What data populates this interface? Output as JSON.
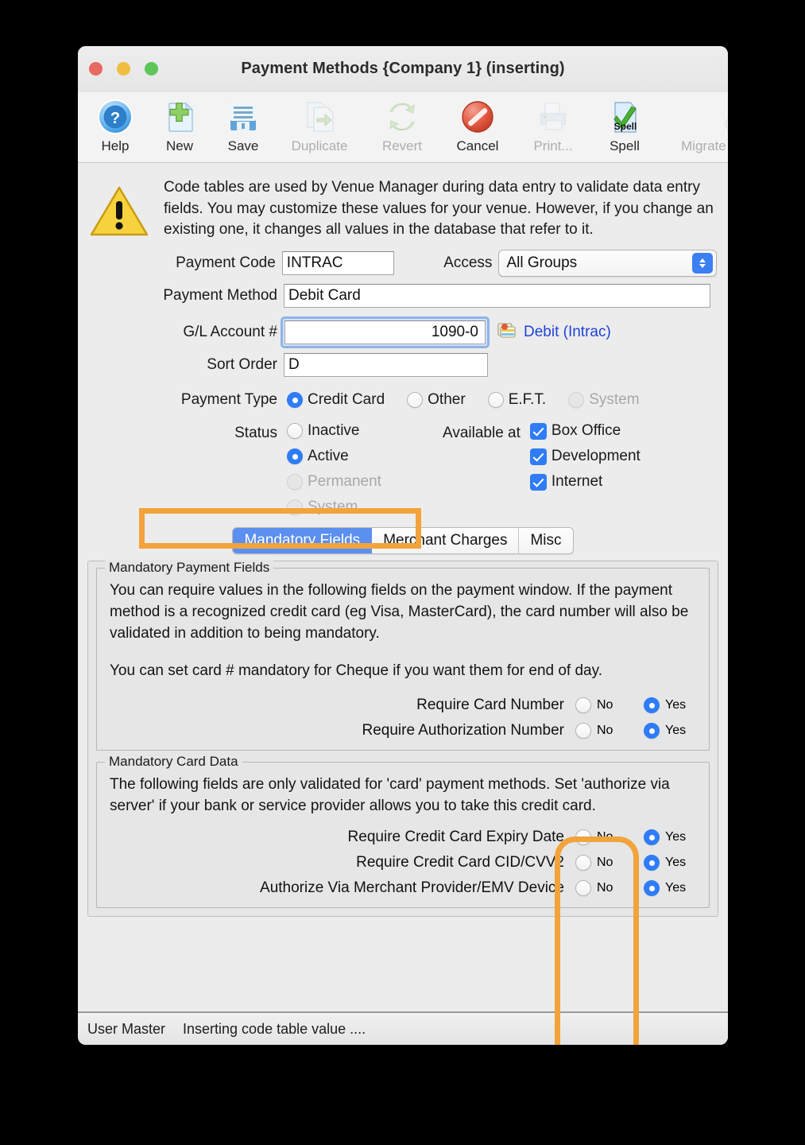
{
  "window": {
    "title": "Payment Methods {Company 1} (inserting)",
    "traffic_lights": [
      "close",
      "minimize",
      "zoom"
    ]
  },
  "toolbar": {
    "buttons": [
      {
        "label": "Help",
        "icon": "help-icon",
        "enabled": true
      },
      {
        "label": "New",
        "icon": "new-document-icon",
        "enabled": true
      },
      {
        "label": "Save",
        "icon": "save-floppy-icon",
        "enabled": true
      },
      {
        "label": "Duplicate",
        "icon": "duplicate-icon",
        "enabled": false
      },
      {
        "label": "Revert",
        "icon": "revert-refresh-icon",
        "enabled": false
      },
      {
        "label": "Cancel",
        "icon": "cancel-icon",
        "enabled": true
      },
      {
        "label": "Print...",
        "icon": "printer-icon",
        "enabled": false
      },
      {
        "label": "Spell",
        "icon": "spell-check-icon",
        "enabled": true
      },
      {
        "label": "Migrate Postdated",
        "icon": "wrench-icon",
        "enabled": false
      }
    ]
  },
  "notice": {
    "icon": "warning-triangle-icon",
    "text": "Code tables are used by Venue Manager during data entry to validate data entry fields.  You may customize these values for your venue.  However, if you change an existing one, it changes all values in the database that refer to it."
  },
  "form": {
    "payment_code": {
      "label": "Payment Code",
      "value": "INTRAC"
    },
    "access": {
      "label": "Access",
      "value": "All Groups"
    },
    "payment_method": {
      "label": "Payment Method",
      "value": "Debit Card"
    },
    "gl_account": {
      "label": "G/L Account #",
      "value": "1090-0",
      "lookup_icon": "account-lookup-icon",
      "link_text": "Debit (Intrac)"
    },
    "sort_order": {
      "label": "Sort Order",
      "value": "D"
    },
    "payment_type": {
      "label": "Payment Type",
      "options": [
        {
          "label": "Credit Card",
          "selected": true,
          "enabled": true
        },
        {
          "label": "Other",
          "selected": false,
          "enabled": true
        },
        {
          "label": "E.F.T.",
          "selected": false,
          "enabled": true
        },
        {
          "label": "System",
          "selected": false,
          "enabled": false
        }
      ]
    },
    "status": {
      "label": "Status",
      "options": [
        {
          "label": "Inactive",
          "selected": false,
          "enabled": true
        },
        {
          "label": "Active",
          "selected": true,
          "enabled": true
        },
        {
          "label": "Permanent",
          "selected": false,
          "enabled": false
        },
        {
          "label": "System",
          "selected": false,
          "enabled": false
        }
      ]
    },
    "available_at": {
      "label": "Available at",
      "options": [
        {
          "label": "Box Office",
          "checked": true
        },
        {
          "label": "Development",
          "checked": true
        },
        {
          "label": "Internet",
          "checked": true
        }
      ]
    }
  },
  "tabs": [
    {
      "label": "Mandatory Fields",
      "active": true
    },
    {
      "label": "Merchant Charges",
      "active": false
    },
    {
      "label": "Misc",
      "active": false
    }
  ],
  "mandatory_payment_fields": {
    "legend": "Mandatory Payment Fields",
    "paragraph1": "You can require values in the following fields on the payment window.  If the payment method is a recognized credit card (eg Visa, MasterCard), the card number will also be validated in addition to being mandatory.",
    "paragraph2": "You can set card # mandatory for Cheque if you want them for end of day.",
    "rows": [
      {
        "label": "Require Card Number",
        "no_label": "No",
        "yes_label": "Yes",
        "value": "Yes"
      },
      {
        "label": "Require Authorization Number",
        "no_label": "No",
        "yes_label": "Yes",
        "value": "Yes"
      }
    ]
  },
  "mandatory_card_data": {
    "legend": "Mandatory Card Data",
    "paragraph1": "The following fields are only validated for 'card' payment methods.  Set 'authorize via server' if your bank or service provider allows you to take this credit card.",
    "rows": [
      {
        "label": "Require Credit Card Expiry Date",
        "no_label": "No",
        "yes_label": "Yes",
        "value": "Yes"
      },
      {
        "label": "Require Credit Card CID/CVV2",
        "no_label": "No",
        "yes_label": "Yes",
        "value": "Yes"
      },
      {
        "label": "Authorize Via Merchant Provider/EMV Device",
        "no_label": "No",
        "yes_label": "Yes",
        "value": "Yes"
      }
    ]
  },
  "statusbar": {
    "left": "User Master",
    "message": "Inserting code table value ...."
  },
  "colors": {
    "highlight": "#f2a33c",
    "accent_blue": "#2f7cf6",
    "tab_active": "#5b8ff0",
    "link": "#1f43d8",
    "window_bg": "#ececec"
  }
}
